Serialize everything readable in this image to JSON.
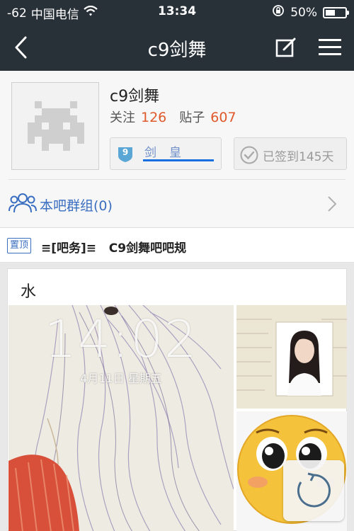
{
  "status_bar": {
    "signal": "-62",
    "carrier": "中国电信",
    "time": "13:34",
    "battery": "50%",
    "battery_level": 0.5
  },
  "nav": {
    "title": "c9剑舞",
    "back_icon": "chevron-left-icon",
    "edit_icon": "edit-icon",
    "menu_icon": "menu-icon"
  },
  "profile": {
    "name": "c9剑舞",
    "follow_label": "关注",
    "follow_count": "126",
    "posts_label": "贴子",
    "posts_count": "607",
    "level_number": "9",
    "level_title": "剑皇",
    "signin_label": "已签到145天"
  },
  "group": {
    "label": "本吧群组(0)"
  },
  "sticky": {
    "tag": "置顶",
    "text": "≡[吧务]≡   C9剑舞吧吧规"
  },
  "post": {
    "title": "水",
    "lock_time": "14:02",
    "lock_date": "4月11日 星期五"
  },
  "colors": {
    "header": "#283038",
    "accent": "#3a6ec0",
    "count": "#e0592a",
    "level_bar": "#1a6fe0"
  }
}
